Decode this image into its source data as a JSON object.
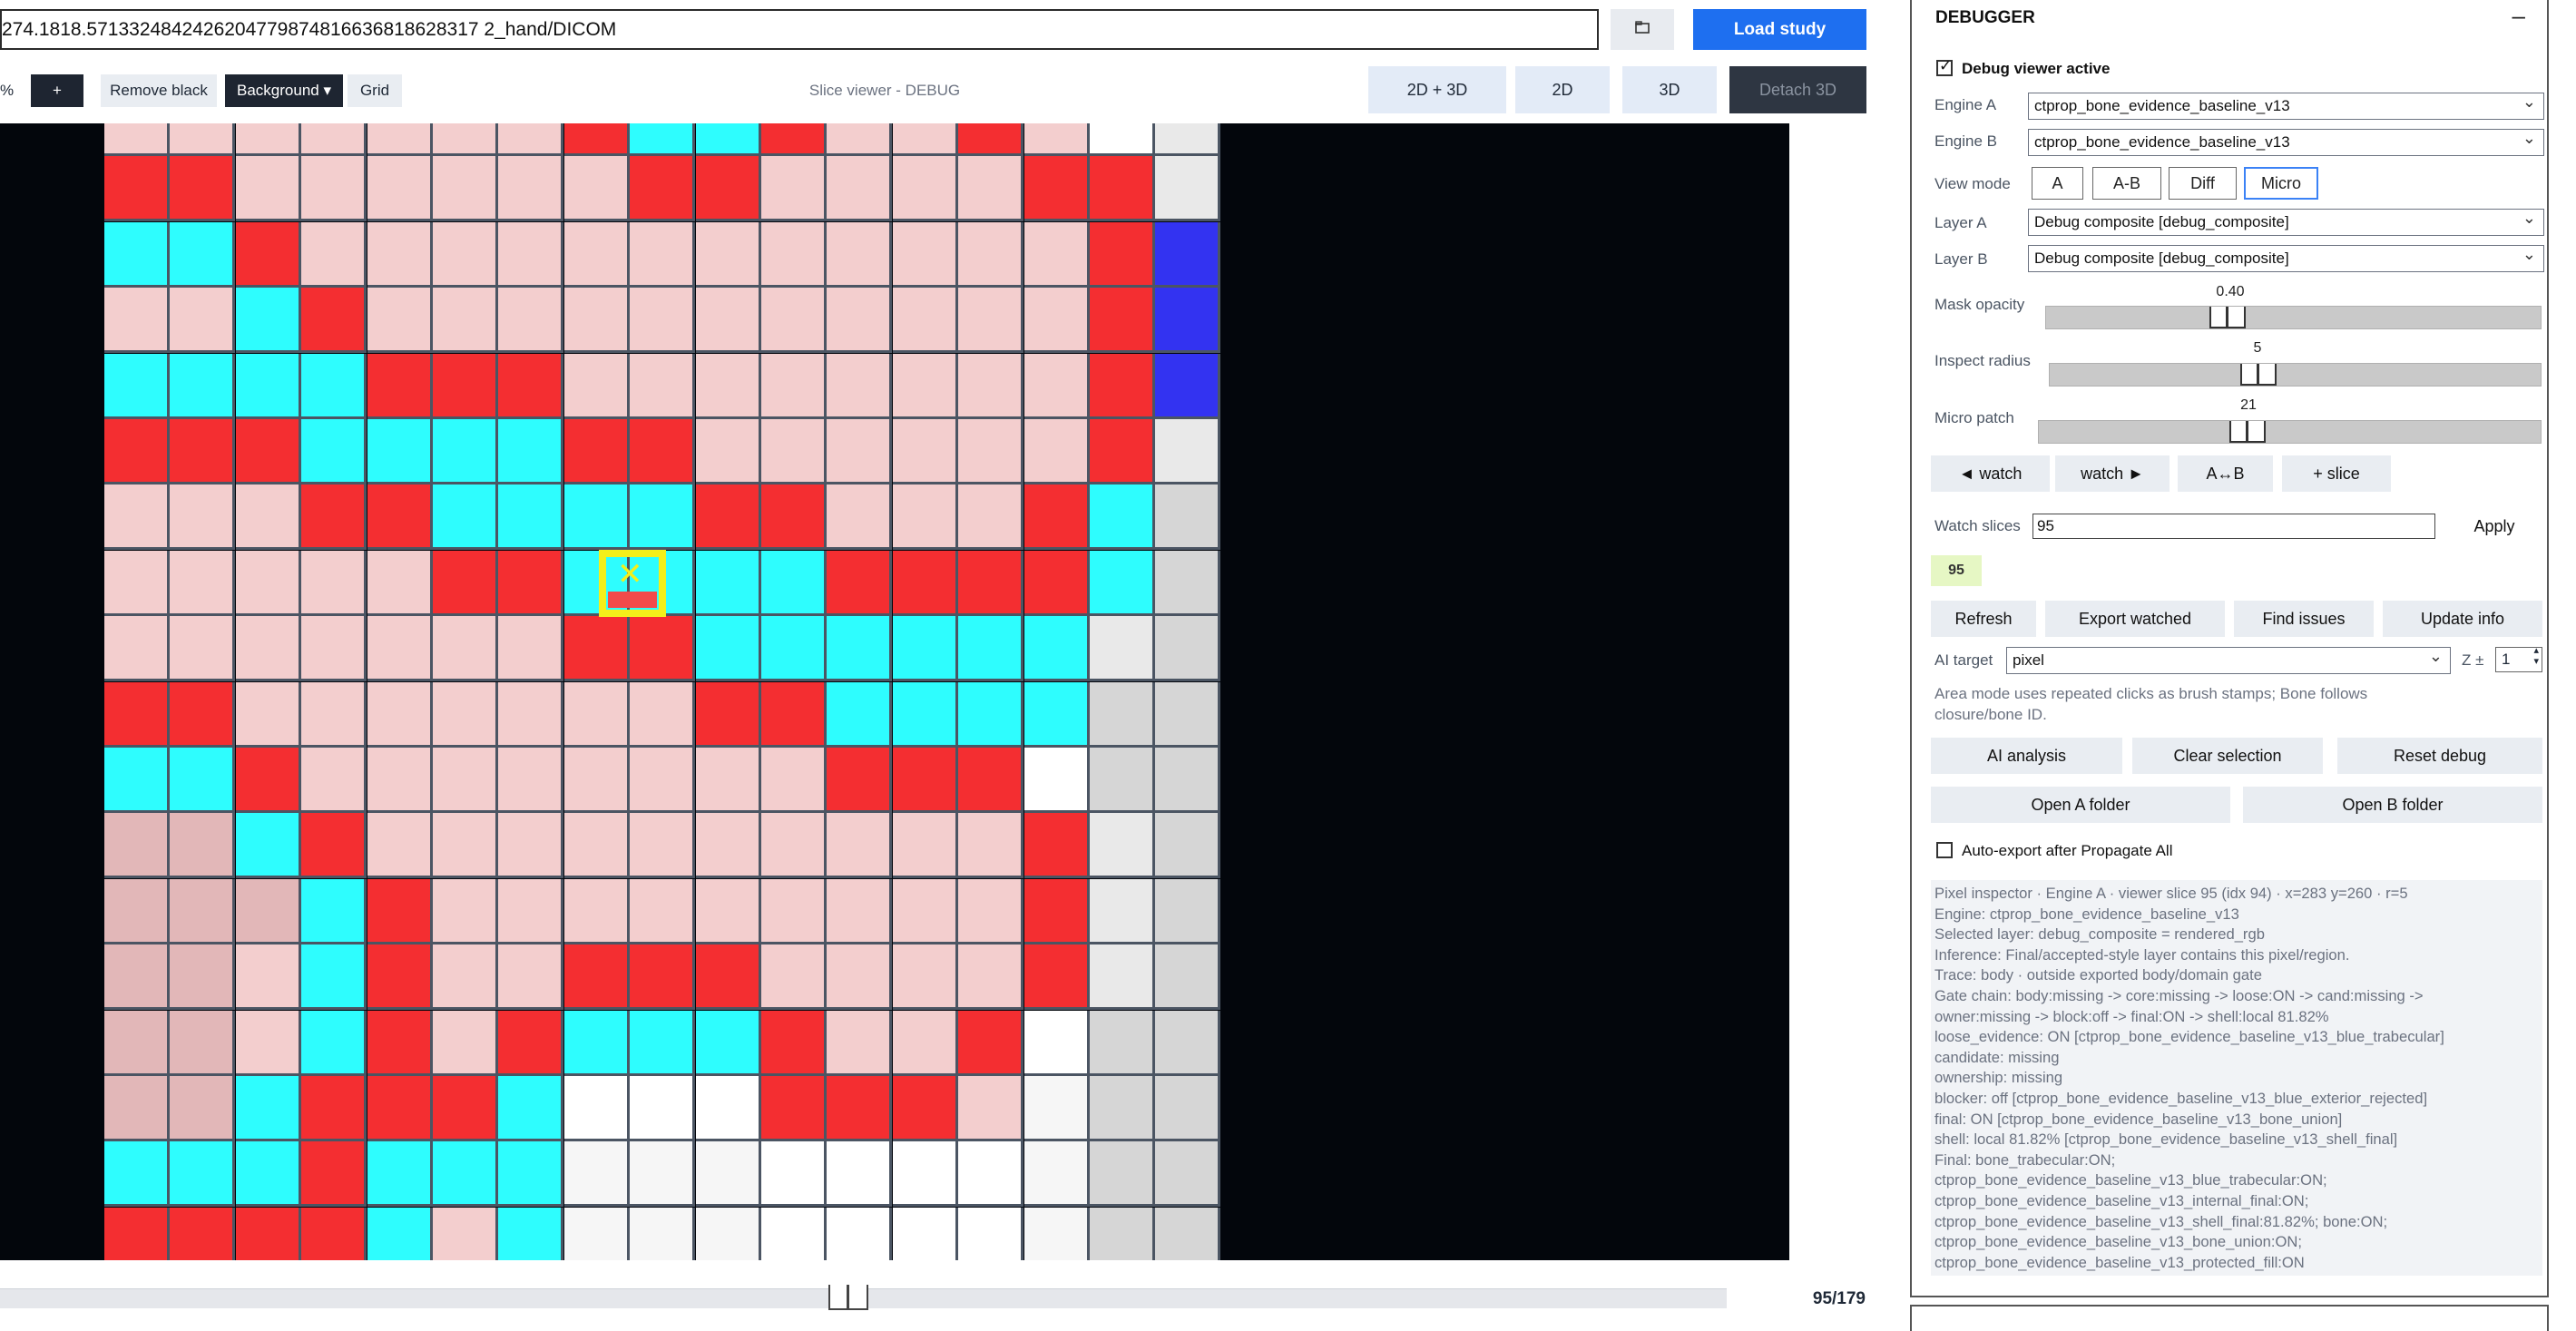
{
  "study": {
    "path": "274.1818.5713324842426204779874816636818628317 2_hand/DICOM",
    "load_label": "Load study",
    "folder_icon": "folder-icon"
  },
  "toolbar": {
    "zoom_pct": "%",
    "plus_label": "+",
    "remove_black_label": "Remove black",
    "background_label": "Background ▾",
    "grid_label": "Grid",
    "viewer_title": "Slice viewer - DEBUG"
  },
  "view_modes": {
    "both": "2D + 3D",
    "two_d": "2D",
    "three_d": "3D",
    "detach": "Detach 3D"
  },
  "grid": {
    "colors": {
      "R": "#f42e31",
      "P": "#f3cece",
      "C": "#2efdfe",
      "D": "#e2b7b8",
      "W": "#ffffff",
      "w": "#f6f6f6",
      "L": "#e9e9e9",
      "G": "#d6d6d6",
      "M": "#c8c8c8",
      "B": "#3333f1",
      "x": "#ececec"
    },
    "rows": [
      "PPPPPPPRCCRPPRPWL",
      "RRPPPPPPRRPPPPRRL",
      "CCRPPPPPPPPPPPPRB",
      "PPCRPPPPPPPPPPPRB",
      "CCCCRRRPPPPPPPPRB",
      "RRRCCCCRRPPPPPPRL",
      "PPPRRCCCCRRPPPRCG",
      "PPPPPRRCCCCRRRRCG",
      "PPPPPPPRRCCCCCCLG",
      "RRPPPPPPPRRCCCCGG",
      "CCRPPPPPPPPRRRWGG",
      "DDCRPPPPPPPPPPRLG",
      "DDDCRPPPPPPPPPRLG",
      "DDPCRPPRRRPPPPRLG",
      "DDPCRPRCCCRPPRWGG",
      "DDCRRRCWWWRRRPwGG",
      "CCCRCCCwwwWWWWwGG",
      "RRRRCPCwwwWWWWwGG"
    ],
    "last_column_top": "W"
  },
  "slider": {
    "counter": "95/179",
    "position": 0.527
  },
  "debugger": {
    "title": "DEBUGGER",
    "collapse_icon": "minus-icon",
    "debug_active_label": "Debug viewer active",
    "debug_active": true,
    "engine_a_label": "Engine A",
    "engine_a_value": "ctprop_bone_evidence_baseline_v13",
    "engine_b_label": "Engine B",
    "engine_b_value": "ctprop_bone_evidence_baseline_v13",
    "view_mode_label": "View mode",
    "view_mode_options": [
      "A",
      "A-B",
      "Diff",
      "Micro"
    ],
    "view_mode_selected": "Micro",
    "layer_a_label": "Layer A",
    "layer_a_value": "Debug composite  [debug_composite]",
    "layer_b_label": "Layer B",
    "layer_b_value": "Debug composite  [debug_composite]",
    "mask_opacity_label": "Mask opacity",
    "mask_opacity_value": "0.40",
    "mask_opacity_fraction": 0.4,
    "inspect_radius_label": "Inspect radius",
    "inspect_radius_value": "5",
    "micro_patch_label": "Micro patch",
    "micro_patch_value": "21",
    "watch_prev_label": "◄ watch",
    "watch_next_label": "watch ►",
    "swap_label": "A↔B",
    "add_slice_label": "+ slice",
    "watch_slices_label": "Watch slices",
    "watch_slices_value": "95",
    "apply_label": "Apply",
    "watched_chip": "95",
    "refresh_label": "Refresh",
    "export_watched_label": "Export watched",
    "find_issues_label": "Find issues",
    "update_info_label": "Update info",
    "ai_target_label": "AI target",
    "ai_target_value": "pixel",
    "z_label": "Z ±",
    "z_value": "1",
    "note_line1": "Area mode uses repeated clicks as brush stamps; Bone follows",
    "note_line2": "closure/bone ID.",
    "ai_analysis_label": "AI analysis",
    "clear_selection_label": "Clear selection",
    "reset_debug_label": "Reset debug",
    "open_a_folder_label": "Open A folder",
    "open_b_folder_label": "Open B folder",
    "auto_export_label": "Auto-export after Propagate All",
    "auto_export": false,
    "inspector_lines": [
      "Pixel inspector · Engine A · viewer slice 95 (idx 94) · x=283 y=260 · r=5",
      "Engine: ctprop_bone_evidence_baseline_v13",
      "Selected layer: debug_composite = rendered_rgb",
      "Inference: Final/accepted-style layer contains this pixel/region.",
      "Trace: body · outside exported body/domain gate",
      "Gate chain: body:missing -> core:missing -> loose:ON -> cand:missing ->",
      "owner:missing -> block:off -> final:ON -> shell:local 81.82%",
      "loose_evidence: ON [ctprop_bone_evidence_baseline_v13_blue_trabecular]",
      "candidate: missing",
      "ownership: missing",
      "blocker: off [ctprop_bone_evidence_baseline_v13_blue_exterior_rejected]",
      "final: ON [ctprop_bone_evidence_baseline_v13_bone_union]",
      "shell: local 81.82% [ctprop_bone_evidence_baseline_v13_shell_final]",
      "Final: bone_trabecular:ON;",
      "ctprop_bone_evidence_baseline_v13_blue_trabecular:ON;",
      "ctprop_bone_evidence_baseline_v13_internal_final:ON;",
      "ctprop_bone_evidence_baseline_v13_shell_final:81.82%; bone:ON;",
      "ctprop_bone_evidence_baseline_v13_bone_union:ON;",
      "ctprop_bone_evidence_baseline_v13_protected_fill:ON"
    ]
  }
}
